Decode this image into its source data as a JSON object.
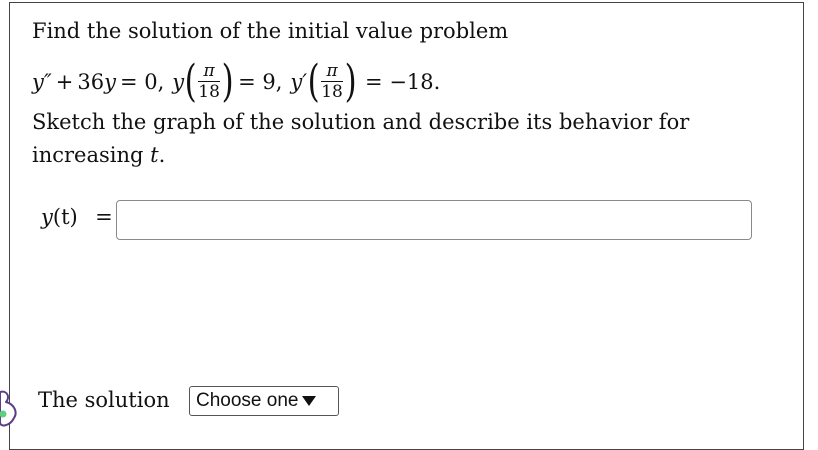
{
  "problem": {
    "line1": "Find the solution of the initial value problem",
    "equation": {
      "y_dbl_prime": "y″",
      "plus": "+",
      "coef": "36",
      "y": "y",
      "equals_zero": "= 0,",
      "y1": "y",
      "pi": "π",
      "den": "18",
      "val1": "= 9,",
      "y_prime": "y′",
      "val2": "= −18."
    },
    "line3": "Sketch the graph of the solution and describe its behavior for",
    "line4_prefix": "increasing ",
    "line4_var": "t",
    "line4_suffix": "."
  },
  "answer": {
    "label_func": "y",
    "label_arg": "(t)",
    "label_eq": "=",
    "input_value": "",
    "input_placeholder": ""
  },
  "solution": {
    "label": "The solution",
    "select_value": "Choose one"
  },
  "icons": {
    "helper": "blob-helper-icon"
  }
}
